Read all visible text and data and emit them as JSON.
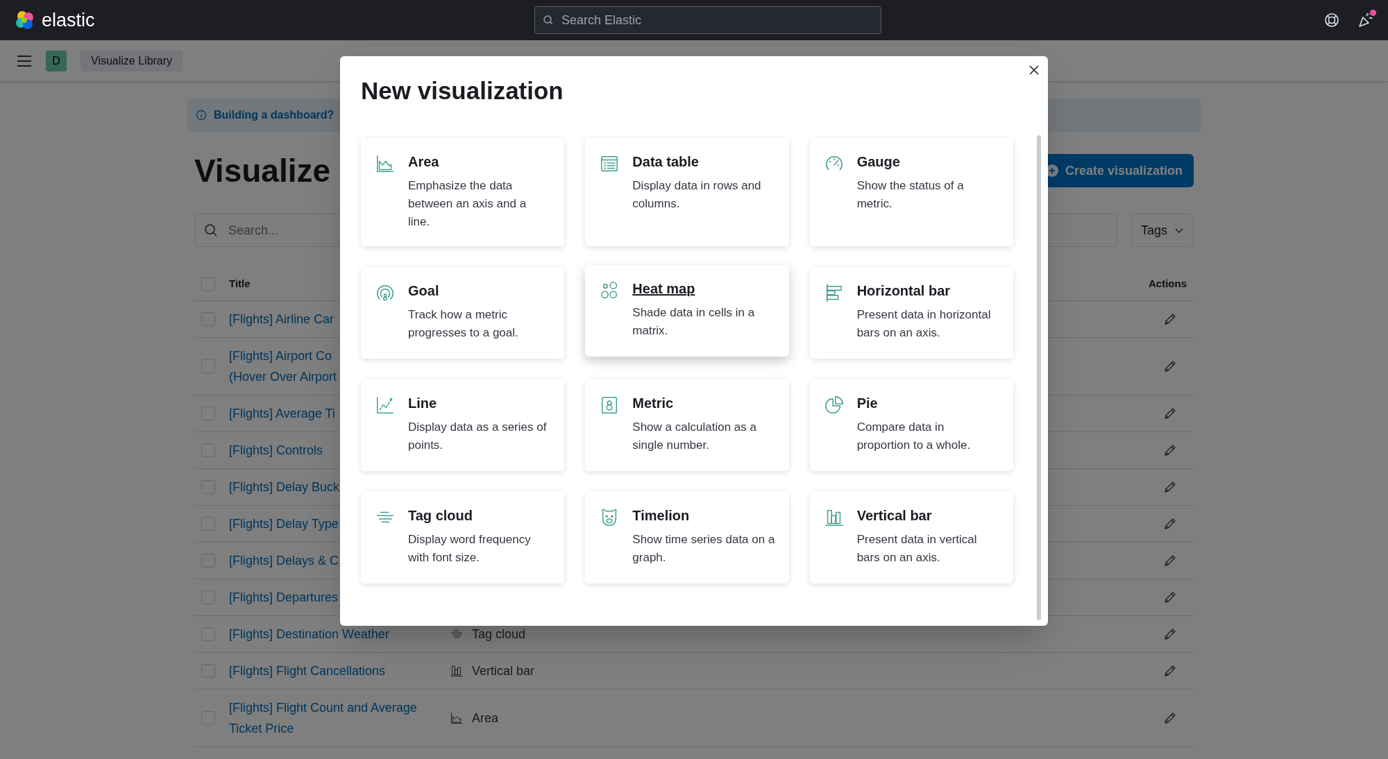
{
  "header": {
    "logo_text": "elastic",
    "search": {
      "placeholder": "Search Elastic"
    },
    "notification_badge": true
  },
  "breadcrumb": {
    "avatar": "D",
    "items": [
      "Visualize Library"
    ]
  },
  "page": {
    "callout": "Building a dashboard?",
    "title": "Visualize",
    "create_button": "Create visualization",
    "search": {
      "placeholder": "Search..."
    },
    "tags_button": "Tags",
    "table": {
      "columns": [
        "Title",
        "Actions"
      ],
      "header_checked": false,
      "rows": [
        {
          "title_lines": [
            "[Flights] Airline Car"
          ],
          "checked": false
        },
        {
          "title_lines": [
            "[Flights] Airport Co",
            "(Hover Over Airport"
          ],
          "checked": false
        },
        {
          "title_lines": [
            "[Flights] Average Ti"
          ],
          "checked": false
        },
        {
          "title_lines": [
            "[Flights] Controls"
          ],
          "checked": false
        },
        {
          "title_lines": [
            "[Flights] Delay Buck"
          ],
          "checked": false
        },
        {
          "title_lines": [
            "[Flights] Delay Type"
          ],
          "checked": false
        },
        {
          "title_lines": [
            "[Flights] Delays & C"
          ],
          "checked": false
        },
        {
          "title_lines": [
            "[Flights] Departures"
          ],
          "checked": false
        },
        {
          "title_lines": [
            "[Flights] Destination Weather"
          ],
          "checked": false,
          "type": {
            "kind": "tagcloud",
            "label": "Tag cloud"
          }
        },
        {
          "title_lines": [
            "[Flights] Flight Cancellations"
          ],
          "checked": false,
          "type": {
            "kind": "vbar",
            "label": "Vertical bar"
          }
        },
        {
          "title_lines": [
            "[Flights] Flight Count and Average",
            "Ticket Price"
          ],
          "checked": false,
          "type": {
            "kind": "area",
            "label": "Area"
          }
        }
      ]
    }
  },
  "modal": {
    "title": "New visualization",
    "cards": [
      {
        "kind": "area",
        "title": "Area",
        "description": "Emphasize the data between an axis and a line.",
        "highlighted": false
      },
      {
        "kind": "table",
        "title": "Data table",
        "description": "Display data in rows and columns.",
        "highlighted": false
      },
      {
        "kind": "gauge",
        "title": "Gauge",
        "description": "Show the status of a metric.",
        "highlighted": false
      },
      {
        "kind": "goal",
        "title": "Goal",
        "description": "Track how a metric progresses to a goal.",
        "highlighted": false
      },
      {
        "kind": "heatmap",
        "title": "Heat map",
        "description": "Shade data in cells in a matrix.",
        "highlighted": true
      },
      {
        "kind": "hbar",
        "title": "Horizontal bar",
        "description": "Present data in horizontal bars on an axis.",
        "highlighted": false
      },
      {
        "kind": "line",
        "title": "Line",
        "description": "Display data as a series of points.",
        "highlighted": false
      },
      {
        "kind": "metric",
        "title": "Metric",
        "description": "Show a calculation as a single number.",
        "highlighted": false
      },
      {
        "kind": "pie",
        "title": "Pie",
        "description": "Compare data in proportion to a whole.",
        "highlighted": false
      },
      {
        "kind": "tagcloud",
        "title": "Tag cloud",
        "description": "Display word frequency with font size.",
        "highlighted": false
      },
      {
        "kind": "timelion",
        "title": "Timelion",
        "description": "Show time series data on a graph.",
        "highlighted": false
      },
      {
        "kind": "vbar",
        "title": "Vertical bar",
        "description": "Present data in vertical bars on an axis.",
        "highlighted": false
      }
    ]
  }
}
